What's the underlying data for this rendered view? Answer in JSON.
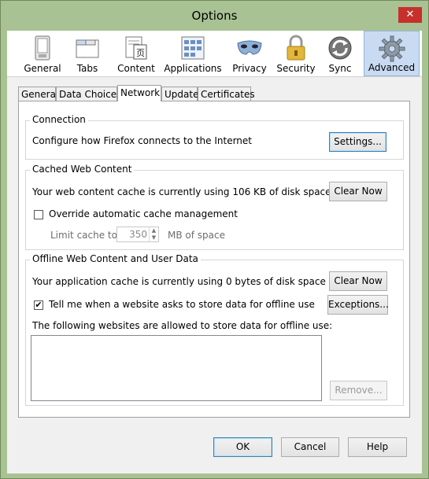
{
  "window": {
    "title": "Options",
    "close_glyph": "✕"
  },
  "toolbar": [
    {
      "key": "general",
      "label": "General",
      "icon": "general-switch-icon"
    },
    {
      "key": "tabs",
      "label": "Tabs",
      "icon": "tabs-window-icon"
    },
    {
      "key": "content",
      "label": "Content",
      "icon": "content-page-icon"
    },
    {
      "key": "applications",
      "label": "Applications",
      "icon": "applications-grid-icon"
    },
    {
      "key": "privacy",
      "label": "Privacy",
      "icon": "privacy-mask-icon"
    },
    {
      "key": "security",
      "label": "Security",
      "icon": "padlock-icon"
    },
    {
      "key": "sync",
      "label": "Sync",
      "icon": "sync-arrows-icon"
    },
    {
      "key": "advanced",
      "label": "Advanced",
      "icon": "gear-icon",
      "active": true
    }
  ],
  "tabs": [
    {
      "label": "General"
    },
    {
      "label": "Data Choices"
    },
    {
      "label": "Network",
      "active": true
    },
    {
      "label": "Update"
    },
    {
      "label": "Certificates"
    }
  ],
  "connection": {
    "title": "Connection",
    "description": "Configure how Firefox connects to the Internet",
    "settings_button": "Settings..."
  },
  "cache": {
    "title": "Cached Web Content",
    "description": "Your web content cache is currently using 106 KB of disk space",
    "clear_button": "Clear Now",
    "override_label": "Override automatic cache management",
    "override_checked": false,
    "limit_label": "Limit cache to",
    "limit_value": "350",
    "limit_unit": "MB of space"
  },
  "offline": {
    "title": "Offline Web Content and User Data",
    "description": "Your application cache is currently using 0 bytes of disk space",
    "clear_button": "Clear Now",
    "tell_me_label": "Tell me when a website asks to store data for offline use",
    "tell_me_checked": true,
    "exceptions_button": "Exceptions...",
    "allowed_label": "The following websites are allowed to store data for offline use:",
    "remove_button": "Remove..."
  },
  "footer": {
    "ok": "OK",
    "cancel": "Cancel",
    "help": "Help"
  },
  "checkmark": "✔"
}
